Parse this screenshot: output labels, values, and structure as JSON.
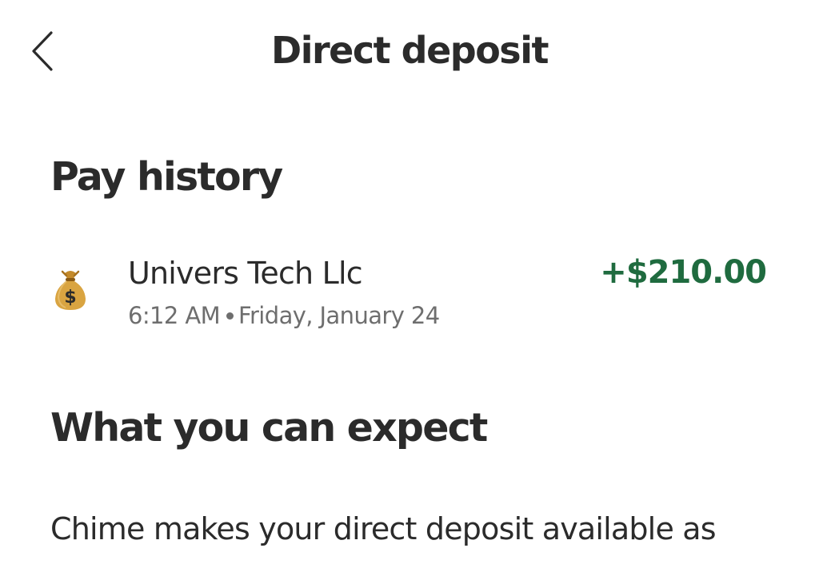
{
  "header": {
    "title": "Direct deposit",
    "back_icon": "chevron-left-icon"
  },
  "pay_history": {
    "heading": "Pay history",
    "items": [
      {
        "icon": "money-bag-icon",
        "name": "Univers Tech Llc",
        "time": "6:12 AM",
        "date": "Friday, January 24",
        "amount": "+$210.00",
        "amount_color": "#1f6b3f"
      }
    ]
  },
  "expect": {
    "heading": "What you can expect",
    "body": "Chime makes your direct deposit available as"
  }
}
